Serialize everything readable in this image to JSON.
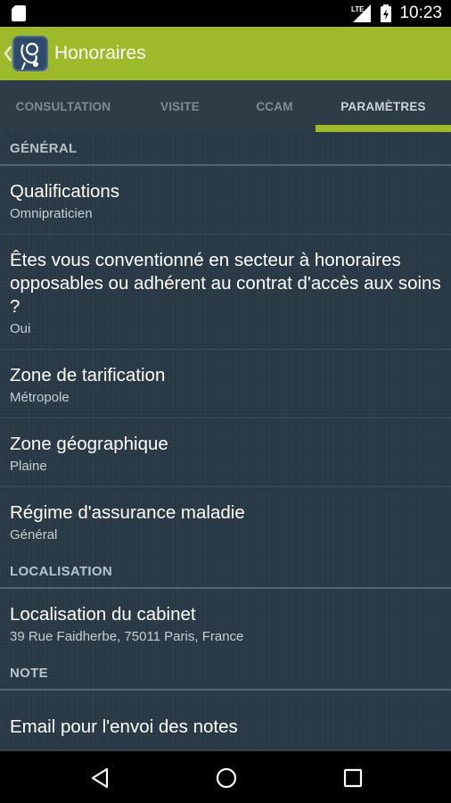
{
  "status_bar": {
    "time": "10:23",
    "network_label": "LTE"
  },
  "app_bar": {
    "title": "Honoraires"
  },
  "tabs": [
    {
      "label": "CONSULTATION"
    },
    {
      "label": "VISITE"
    },
    {
      "label": "CCAM"
    },
    {
      "label": "PARAMÈTRES",
      "active": true
    }
  ],
  "sections": {
    "general": {
      "header": "GÉNÉRAL",
      "items": [
        {
          "title": "Qualifications",
          "summary": "Omnipraticien"
        },
        {
          "title": "Êtes vous conventionné en secteur à honoraires opposables ou adhérent au contrat d'accès aux soins ?",
          "summary": "Oui"
        },
        {
          "title": "Zone de tarification",
          "summary": "Métropole"
        },
        {
          "title": "Zone géographique",
          "summary": "Plaine"
        },
        {
          "title": "Régime d'assurance maladie",
          "summary": "Général"
        }
      ]
    },
    "localisation": {
      "header": "LOCALISATION",
      "items": [
        {
          "title": "Localisation du cabinet",
          "summary": "39 Rue Faidherbe, 75011 Paris, France"
        }
      ]
    },
    "note": {
      "header": "NOTE",
      "items": [
        {
          "title": "Email pour l'envoi des notes"
        }
      ]
    }
  },
  "colors": {
    "accent": "#9dba2b",
    "tab_bar": "#2e3c48",
    "content_bg": "#2a3946"
  },
  "icons": [
    "sd-card-icon",
    "lte-signal-icon",
    "battery-charging-icon",
    "back-chevron-icon",
    "stethoscope-app-icon",
    "nav-back-icon",
    "nav-home-icon",
    "nav-recents-icon"
  ]
}
